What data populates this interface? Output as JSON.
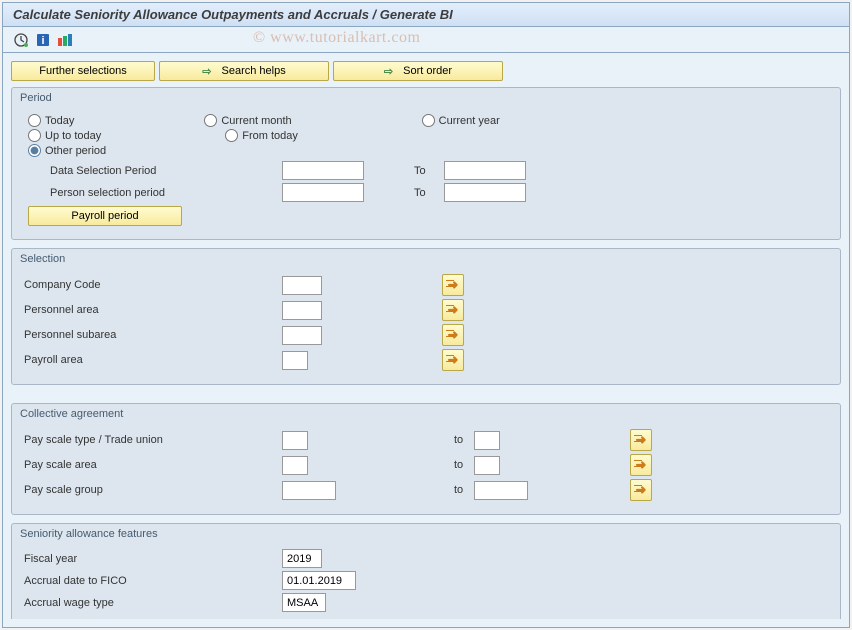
{
  "watermark": "© www.tutorialkart.com",
  "title": "Calculate Seniority Allowance Outpayments and Accruals / Generate BI",
  "topButtons": {
    "further": "Further selections",
    "search": "Search helps",
    "sort": "Sort order"
  },
  "period": {
    "legend": "Period",
    "today": "Today",
    "currentMonth": "Current month",
    "currentYear": "Current year",
    "upToToday": "Up to today",
    "fromToday": "From today",
    "other": "Other period",
    "dataSel": "Data Selection Period",
    "personSel": "Person selection period",
    "to": "To",
    "payrollBtn": "Payroll period",
    "dataSelFrom": "",
    "dataSelTo": "",
    "personSelFrom": "",
    "personSelTo": ""
  },
  "selection": {
    "legend": "Selection",
    "companyCode": "Company Code",
    "personnelArea": "Personnel area",
    "personnelSubarea": "Personnel subarea",
    "payrollArea": "Payroll area",
    "vals": {
      "cc": "",
      "pa": "",
      "ps": "",
      "py": ""
    }
  },
  "collective": {
    "legend": "Collective agreement",
    "payScaleType": "Pay scale type / Trade union",
    "payScaleArea": "Pay scale area",
    "payScaleGroup": "Pay scale group",
    "to": "to",
    "vals": {
      "t1": "",
      "t2": "",
      "a1": "",
      "a2": "",
      "g1": "",
      "g2": ""
    }
  },
  "seniority": {
    "legend": "Seniority allowance features",
    "fiscalYear": "Fiscal year",
    "fiscalYearVal": "2019",
    "accrualDate": "Accrual date to FICO",
    "accrualDateVal": "01.01.2019",
    "accrualWage": "Accrual wage type",
    "accrualWageVal": "MSAA"
  }
}
